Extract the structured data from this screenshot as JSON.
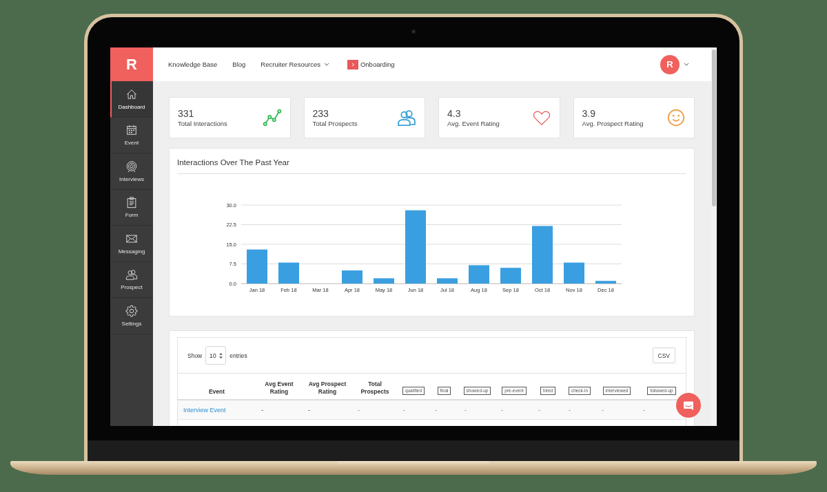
{
  "sidebar": {
    "logo": "R",
    "items": [
      {
        "label": "Dashboard",
        "selected": true
      },
      {
        "label": "Event",
        "selected": false
      },
      {
        "label": "Interviews",
        "selected": false
      },
      {
        "label": "Form",
        "selected": false
      },
      {
        "label": "Messaging",
        "selected": false
      },
      {
        "label": "Prospect",
        "selected": false
      },
      {
        "label": "Settings",
        "selected": false
      }
    ]
  },
  "top_bar": {
    "links": [
      {
        "label": "Knowledge Base",
        "kind": "link"
      },
      {
        "label": "Blog",
        "kind": "link"
      },
      {
        "label": "Recruiter Resources",
        "kind": "dropdown"
      },
      {
        "label": "Onboarding",
        "kind": "badged"
      }
    ],
    "avatar": "R"
  },
  "stats": [
    {
      "value": "331",
      "label": "Total Interactions",
      "color": "#3cb95b"
    },
    {
      "value": "233",
      "label": "Total Prospects",
      "color": "#3a9fd6"
    },
    {
      "value": "4.3",
      "label": "Avg. Event Rating",
      "color": "#e8585a"
    },
    {
      "value": "3.9",
      "label": "Avg. Prospect Rating",
      "color": "#f0a04b"
    }
  ],
  "interactions_card": {
    "chart_data": {
      "type": "bar",
      "title": "Interactions Over The Past Year",
      "categories": [
        "Jan 18",
        "Feb 18",
        "Mar 18",
        "Apr 18",
        "May 18",
        "Jun 18",
        "Jul 18",
        "Aug 18",
        "Sep 18",
        "Oct 18",
        "Nov 18",
        "Dec 18"
      ],
      "values": [
        13,
        8,
        0,
        5,
        2,
        28,
        2,
        7,
        6,
        22,
        8,
        1
      ],
      "ylim": [
        0,
        30
      ],
      "yticks": [
        {
          "value": 0,
          "label": "0.0"
        },
        {
          "value": 7.5,
          "label": "7.5"
        },
        {
          "value": 15,
          "label": "15.0"
        },
        {
          "value": 22.5,
          "label": "22.5"
        },
        {
          "value": 30,
          "label": "30.0"
        }
      ],
      "grid": true
    }
  },
  "events_table": {
    "length_menu": {
      "before": "Show",
      "value": "10",
      "after": "entries"
    },
    "export_button": "CSV",
    "columns": [
      {
        "label": "Event",
        "kind": "text"
      },
      {
        "label": "Avg Event Rating",
        "kind": "text"
      },
      {
        "label": "Avg Prospect Rating",
        "kind": "text"
      },
      {
        "label": "Total Prospects",
        "kind": "text"
      },
      {
        "label": "qualified",
        "kind": "tag"
      },
      {
        "label": "final",
        "kind": "tag"
      },
      {
        "label": "showed-up",
        "kind": "tag"
      },
      {
        "label": "pre-event",
        "kind": "tag"
      },
      {
        "label": "hired",
        "kind": "tag"
      },
      {
        "label": "check-in",
        "kind": "tag"
      },
      {
        "label": "interviewed",
        "kind": "tag"
      },
      {
        "label": "followed-up",
        "kind": "tag"
      }
    ],
    "rows": [
      {
        "cells": [
          {
            "text": "Interview Event",
            "kind": "link"
          },
          {
            "text": "-",
            "kind": "text"
          },
          {
            "text": "-",
            "kind": "text"
          },
          {
            "text": "-",
            "kind": "link"
          },
          {
            "text": "-",
            "kind": "link"
          },
          {
            "text": "-",
            "kind": "link"
          },
          {
            "text": "-",
            "kind": "link"
          },
          {
            "text": "-",
            "kind": "link"
          },
          {
            "text": "-",
            "kind": "link"
          },
          {
            "text": "-",
            "kind": "link"
          },
          {
            "text": "-",
            "kind": "link"
          },
          {
            "text": "-",
            "kind": "link"
          }
        ]
      }
    ]
  }
}
